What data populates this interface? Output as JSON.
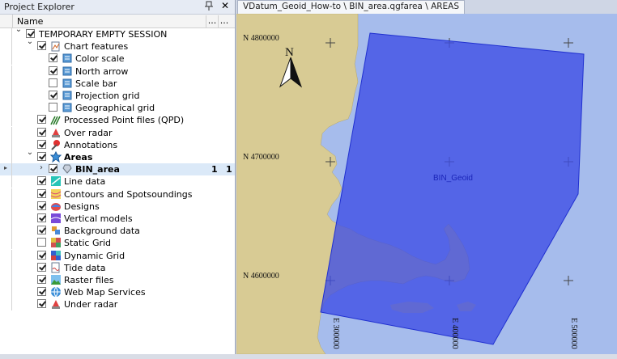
{
  "explorer": {
    "title": "Project Explorer",
    "pin_icon": "pin-icon",
    "close_glyph": "✕",
    "columns": {
      "name": "Name",
      "c1": "...",
      "c2": "..."
    }
  },
  "tree": [
    {
      "label": "TEMPORARY EMPTY SESSION",
      "indent": 0,
      "exp": "down",
      "checked": true,
      "icon": "session-icon"
    },
    {
      "label": "Chart features",
      "indent": 1,
      "exp": "down",
      "checked": true,
      "icon": "chart-features-icon"
    },
    {
      "label": "Color scale",
      "indent": 2,
      "exp": "",
      "checked": true,
      "icon": "layer-icon"
    },
    {
      "label": "North arrow",
      "indent": 2,
      "exp": "",
      "checked": true,
      "icon": "layer-icon"
    },
    {
      "label": "Scale bar",
      "indent": 2,
      "exp": "",
      "checked": false,
      "icon": "layer-icon"
    },
    {
      "label": "Projection grid",
      "indent": 2,
      "exp": "",
      "checked": true,
      "icon": "layer-icon"
    },
    {
      "label": "Geographical grid",
      "indent": 2,
      "exp": "",
      "checked": false,
      "icon": "layer-icon"
    },
    {
      "label": "Processed Point files (QPD)",
      "indent": 1,
      "exp": "",
      "checked": true,
      "icon": "qpd-icon"
    },
    {
      "label": "Over radar",
      "indent": 1,
      "exp": "",
      "checked": true,
      "icon": "radar-icon"
    },
    {
      "label": "Annotations",
      "indent": 1,
      "exp": "",
      "checked": true,
      "icon": "annotation-icon"
    },
    {
      "label": "Areas",
      "indent": 1,
      "exp": "down",
      "checked": true,
      "icon": "areas-icon",
      "bold": true
    },
    {
      "label": "BIN_area",
      "indent": 2,
      "exp": "right",
      "checked": true,
      "icon": "area-item-icon",
      "bold": true,
      "selected": true,
      "c1": "1",
      "c2": "1"
    },
    {
      "label": "Line data",
      "indent": 1,
      "exp": "",
      "checked": true,
      "icon": "line-data-icon"
    },
    {
      "label": "Contours and Spotsoundings",
      "indent": 1,
      "exp": "",
      "checked": true,
      "icon": "contours-icon"
    },
    {
      "label": "Designs",
      "indent": 1,
      "exp": "",
      "checked": true,
      "icon": "designs-icon"
    },
    {
      "label": "Vertical models",
      "indent": 1,
      "exp": "",
      "checked": true,
      "icon": "vertical-models-icon"
    },
    {
      "label": "Background data",
      "indent": 1,
      "exp": "",
      "checked": true,
      "icon": "background-data-icon"
    },
    {
      "label": "Static Grid",
      "indent": 1,
      "exp": "",
      "checked": false,
      "icon": "static-grid-icon"
    },
    {
      "label": "Dynamic Grid",
      "indent": 1,
      "exp": "",
      "checked": true,
      "icon": "dynamic-grid-icon"
    },
    {
      "label": "Tide data",
      "indent": 1,
      "exp": "",
      "checked": true,
      "icon": "tide-icon"
    },
    {
      "label": "Raster files",
      "indent": 1,
      "exp": "",
      "checked": true,
      "icon": "raster-icon"
    },
    {
      "label": "Web Map Services",
      "indent": 1,
      "exp": "",
      "checked": true,
      "icon": "wms-icon"
    },
    {
      "label": "Under radar",
      "indent": 1,
      "exp": "",
      "checked": true,
      "icon": "radar-icon"
    }
  ],
  "map": {
    "tab_title": "VDatum_Geoid_How-to \\ BIN_area.qgfarea \\ AREAS",
    "north_label": "N",
    "area_label": "BIN_Geoid",
    "northings": [
      "N 4800000",
      "N 4700000",
      "N 4600000"
    ],
    "eastings": [
      "E 300000",
      "E 400000",
      "E 500000"
    ],
    "colors": {
      "water": "#a6bcec",
      "land": "#d8cb94",
      "area_fill": "#3d4de6",
      "area_stroke": "#2030d0"
    }
  }
}
